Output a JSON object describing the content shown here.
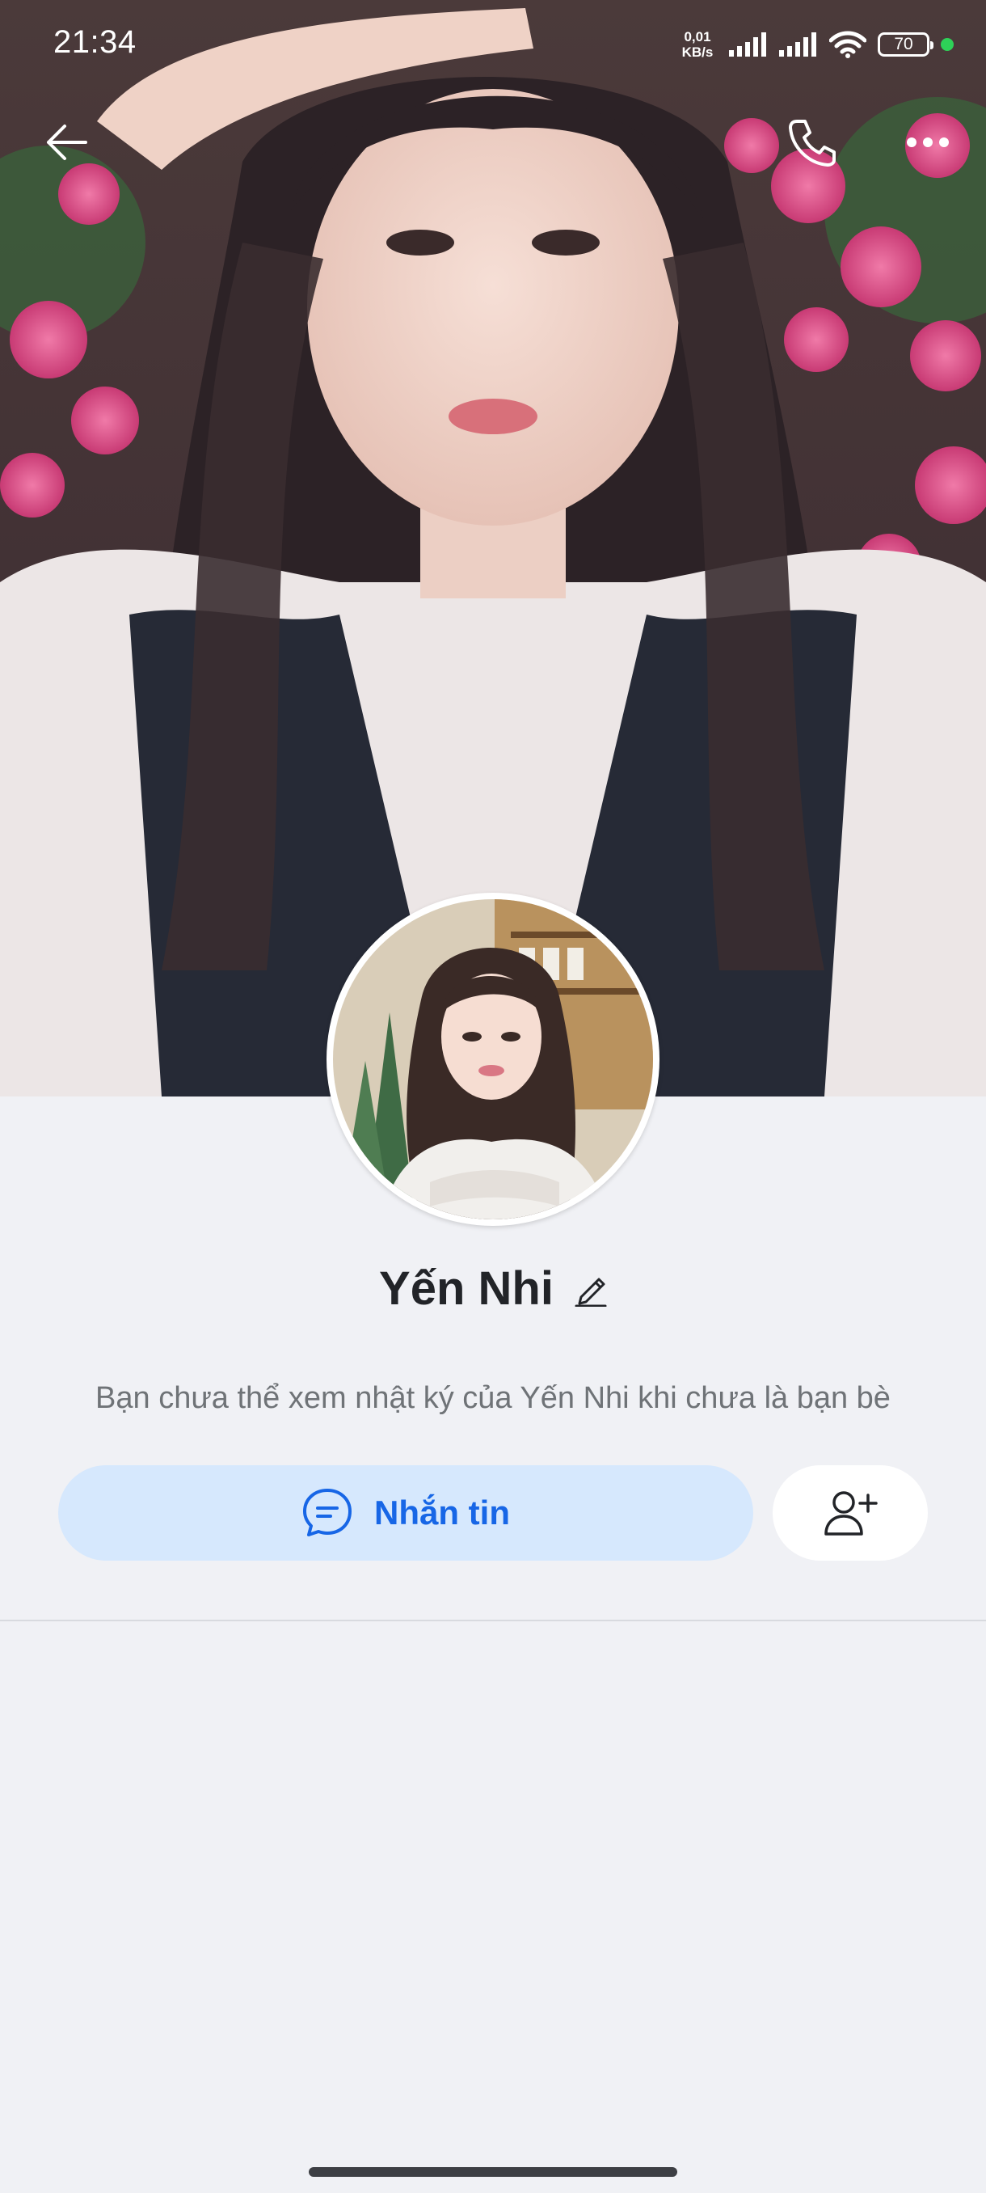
{
  "status_bar": {
    "time": "21:34",
    "net_speed_value": "0,01",
    "net_speed_unit": "KB/s",
    "battery": "70"
  },
  "icons": {
    "back": "arrow-left-icon",
    "call": "phone-icon",
    "more": "more-horizontal-icon",
    "edit": "pencil-icon",
    "message": "chat-bubble-icon",
    "add_friend": "add-user-icon"
  },
  "profile": {
    "name": "Yến Nhi",
    "notice": "Bạn chưa thể xem nhật ký của Yến Nhi khi chưa là bạn bè"
  },
  "actions": {
    "message_label": "Nhắn tin"
  },
  "colors": {
    "accent": "#1766e6",
    "message_button_bg": "#d6e8fd",
    "page_bg": "#f0f1f5"
  }
}
